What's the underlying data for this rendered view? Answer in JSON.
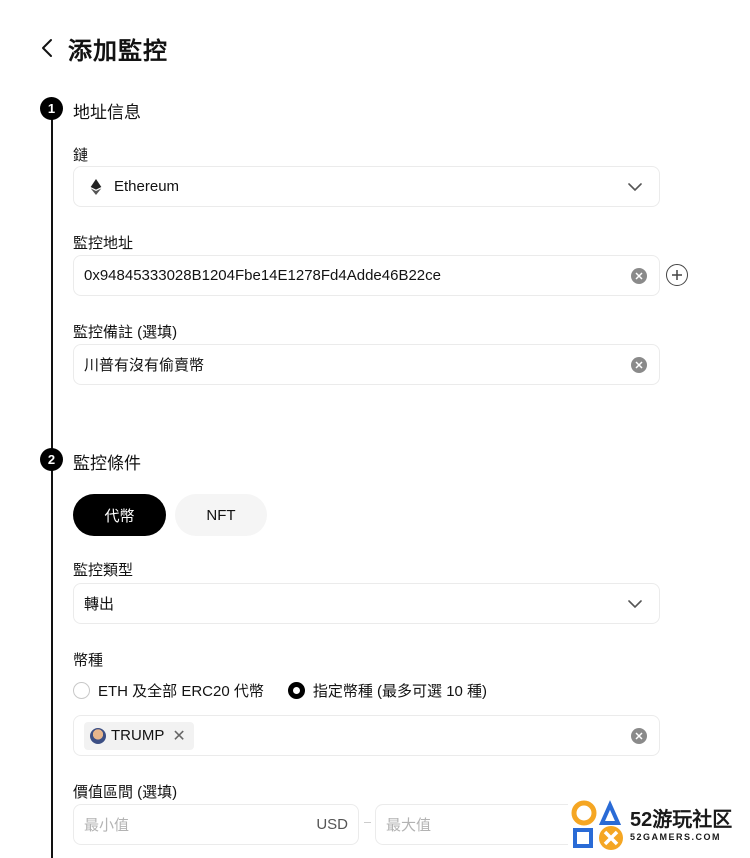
{
  "header": {
    "title": "添加監控"
  },
  "section1": {
    "number": "1",
    "title": "地址信息",
    "chain": {
      "label": "鏈",
      "value": "Ethereum"
    },
    "address": {
      "label": "監控地址",
      "value": "0x94845333028B1204Fbe14E1278Fd4Adde46B22ce"
    },
    "note": {
      "label": "監控備註 (選填)",
      "value": "川普有沒有偷賣幣"
    }
  },
  "section2": {
    "number": "2",
    "title": "監控條件",
    "tabs": [
      {
        "label": "代幣",
        "active": true
      },
      {
        "label": "NFT",
        "active": false
      }
    ],
    "monitor_type": {
      "label": "監控類型",
      "value": "轉出"
    },
    "currency": {
      "label": "幣種",
      "options": [
        {
          "label": "ETH 及全部 ERC20 代幣",
          "selected": false
        },
        {
          "label": "指定幣種 (最多可選 10 種)",
          "selected": true
        }
      ],
      "selected_tokens": [
        {
          "symbol": "TRUMP"
        }
      ]
    },
    "value_range": {
      "label": "價值區間 (選填)",
      "min_placeholder": "最小值",
      "min_unit": "USD",
      "max_placeholder": "最大值"
    }
  },
  "watermark": {
    "main": "52游玩社区",
    "sub": "52GAMERS.COM"
  }
}
